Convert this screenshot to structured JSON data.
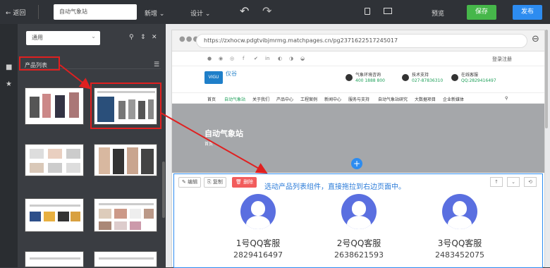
{
  "topbar": {
    "back": "返回",
    "page_name": "自动气象站",
    "menu1": "新增",
    "menu2": "设计",
    "preview": "预览",
    "save": "保存",
    "publish": "发布"
  },
  "panel": {
    "select": "通用",
    "category": "产品列表"
  },
  "browser": {
    "url": "https://zxhocw.pdgtvibjmrmg.matchpages.cn/pg2371622517245017",
    "login": "登录注册"
  },
  "site": {
    "logo": "VIGU",
    "logo_cn": "仪谷",
    "hotline_label": "气象环境咨询",
    "hotline": "400 1888 800",
    "tech_label": "技术支持",
    "tech": "027-87836310",
    "service_label": "在线客服",
    "service": "QQ:2829416497",
    "nav": [
      "首页",
      "自动气象站",
      "关于我们",
      "产品中心",
      "工程案例",
      "新闻中心",
      "服务与支持",
      "自动气象站研究",
      "大数据项目",
      "企业新媒体"
    ],
    "banner_title": "自动气象站",
    "crumb": "首页"
  },
  "component": {
    "edit": "编辑",
    "copy": "复制",
    "delete": "删除",
    "caption": "选动产品列表组件，直接拖拉到右边页面中。",
    "up": "↑",
    "down": "⌄",
    "more": "⟲"
  },
  "contacts": [
    {
      "name": "1号QQ客服",
      "number": "2829416497"
    },
    {
      "name": "2号QQ客服",
      "number": "2638621593"
    },
    {
      "name": "3号QQ客服",
      "number": "2483452075"
    }
  ],
  "colors": {
    "accent": "#2d8cf0",
    "save": "#46b74a",
    "annotation": "#e02020",
    "avatar": "#5a6fe0"
  }
}
